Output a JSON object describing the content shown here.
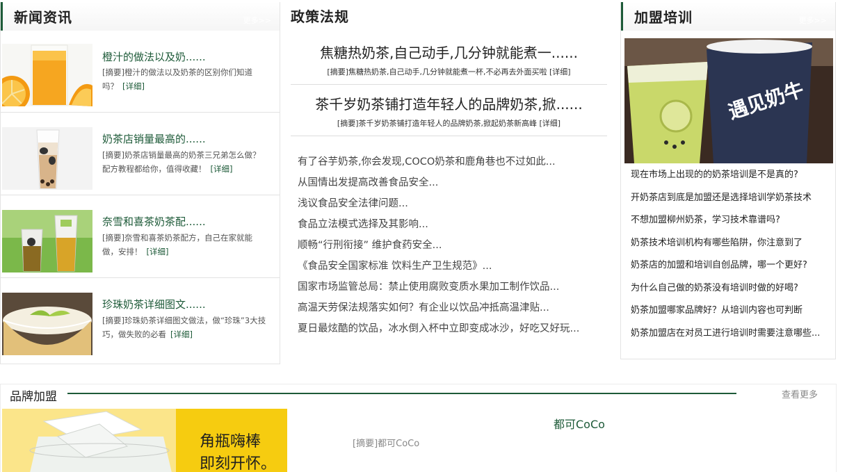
{
  "news": {
    "title": "新闻资讯",
    "more": "更多>>",
    "items": [
      {
        "title": "橙汁的做法以及奶......",
        "summary": "[摘要]橙汁的做法以及奶茶的区别你们知道吗？",
        "detail": "[详细]",
        "image": "orange-juice-photo"
      },
      {
        "title": "奶茶店销量最高的......",
        "summary": "[摘要]奶茶店销量最高的奶茶三兄弟怎么做？配方教程都给你，值得收藏！",
        "detail": "[详细]",
        "image": "milk-tea-cup-photo"
      },
      {
        "title": "奈雪和喜茶奶茶配......",
        "summary": "[摘要]奈雪和喜茶奶茶配方，自己在家就能做，安排！",
        "detail": "[详细]",
        "image": "fruit-tea-cups-photo"
      },
      {
        "title": "珍珠奶茶详细图文......",
        "summary": "[摘要]珍珠奶茶详细图文做法，做“珍珠”3大技巧，做失败的必看",
        "detail": "[详细]",
        "image": "pudding-bowl-photo"
      }
    ]
  },
  "policy": {
    "title": "政策法规",
    "featured": [
      {
        "title": "焦糖热奶茶,自己动手,几分钟就能煮一......",
        "summary": "[摘要]焦糖热奶茶,自己动手,几分钟就能煮一杯,不必再去外面买啦",
        "detail": "[详细]"
      },
      {
        "title": "茶千岁奶茶铺打造年轻人的品牌奶茶,掀......",
        "summary": "[摘要]茶千岁奶茶铺打造年轻人的品牌奶茶,掀起奶茶新高峰",
        "detail": "[详细]"
      }
    ],
    "list": [
      "有了谷芋奶茶,你会发现,COCO奶茶和鹿角巷也不过如此...",
      "从国情出发提高改善食品安全...",
      "浅议食品安全法律问题...",
      "食品立法模式选择及其影响...",
      "顺畅“行刑衔接” 维护食药安全...",
      "《食品安全国家标准 饮料生产卫生规范》...",
      "国家市场监管总局：禁止使用腐败变质水果加工制作饮品...",
      "高温天劳保法规落实如何？有企业以饮品冲抵高温津贴...",
      "夏日最炫酷的饮品，冰水倒入杯中立即变成冰沙，好吃又好玩..."
    ]
  },
  "training": {
    "title": "加盟培训",
    "more": "更多>>",
    "photo_text": "遇见奶牛",
    "list": [
      "现在市场上出现的的奶茶培训是不是真的?",
      "开奶茶店到底是加盟还是选择培训学奶茶技术",
      "不想加盟柳州奶茶，学习技术靠谱吗?",
      "奶茶技术培训机构有哪些陷阱，你注意到了",
      "奶茶店的加盟和培训自创品牌，哪一个更好?",
      "为什么自己做的奶茶没有培训时做的好喝?",
      "奶茶加盟哪家品牌好？从培训内容也可判断",
      "奶茶加盟店在对员工进行培训时需要注意哪些..."
    ]
  },
  "brand": {
    "title": "品牌加盟",
    "more": "查看更多",
    "banner_text_1": "角瓶嗨棒",
    "banner_text_2": "即刻开怀。",
    "item_title": "都可CoCo",
    "item_summary": "[摘要]都可CoCo"
  },
  "colors": {
    "accent": "#1d5a38",
    "banner_yellow": "#f6cc10"
  }
}
